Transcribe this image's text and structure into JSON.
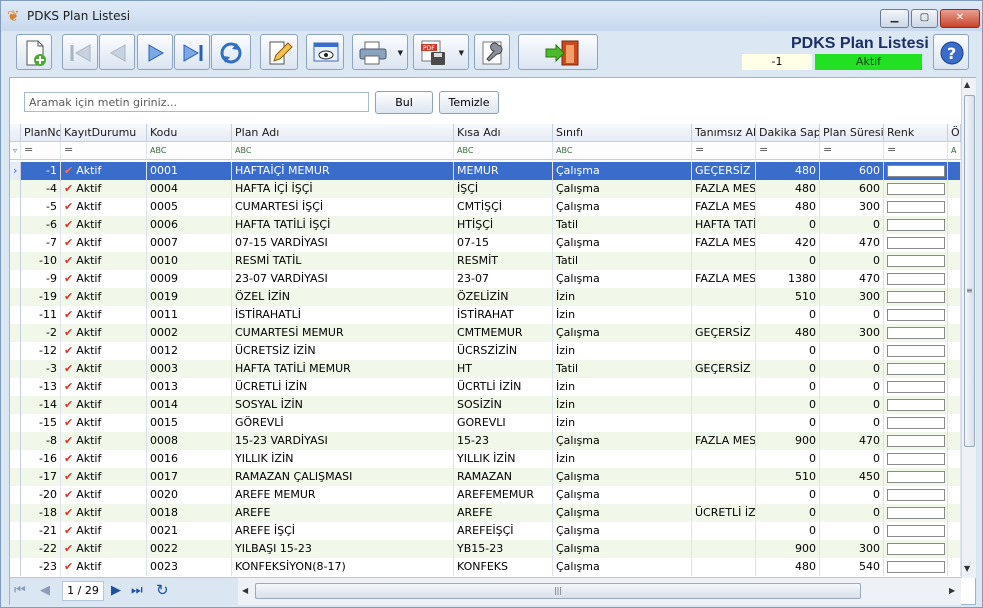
{
  "window": {
    "title": "PDKS Plan Listesi"
  },
  "toolbar": {
    "buttons": [
      {
        "name": "new-record-button",
        "icon": "new-document-icon"
      },
      {
        "name": "first-record-button",
        "icon": "first-icon"
      },
      {
        "name": "previous-record-button",
        "icon": "previous-icon"
      },
      {
        "name": "next-record-button",
        "icon": "next-icon"
      },
      {
        "name": "last-record-button",
        "icon": "last-icon"
      },
      {
        "name": "refresh-button",
        "icon": "refresh-icon"
      },
      {
        "name": "edit-button",
        "icon": "edit-icon"
      },
      {
        "name": "preview-button",
        "icon": "preview-icon"
      },
      {
        "name": "print-button",
        "icon": "printer-icon"
      },
      {
        "name": "export-pdf-button",
        "icon": "pdf-icon"
      },
      {
        "name": "settings-button",
        "icon": "wrench-icon"
      },
      {
        "name": "exit-button",
        "icon": "exit-door-icon"
      }
    ]
  },
  "header": {
    "title": "PDKS Plan Listesi",
    "record_id": "-1",
    "status": "Aktif"
  },
  "search": {
    "placeholder": "Aramak için metin giriniz...",
    "find_label": "Bul",
    "clear_label": "Temizle"
  },
  "grid": {
    "columns": [
      "PlanNo",
      "KayıtDurumu",
      "Kodu",
      "Plan Adı",
      "Kısa Adı",
      "Sınıfı",
      "Tanımsız Akt",
      "Dakika Sapm",
      "Plan Süresi",
      "Renk",
      "Ö"
    ],
    "filter_markers": [
      "=",
      "=",
      "ABC",
      "ABC",
      "ABC",
      "ABC",
      "=",
      "=",
      "=",
      "=",
      "A"
    ],
    "rows": [
      [
        "-1",
        "Aktif",
        "0001",
        "HAFTAİÇİ MEMUR",
        "MEMUR",
        "Çalışma",
        "GEÇERSİZ",
        "480",
        "600"
      ],
      [
        "-4",
        "Aktif",
        "0004",
        "HAFTA İÇİ İŞÇİ",
        "İŞÇİ",
        "Çalışma",
        "FAZLA MESA",
        "480",
        "600"
      ],
      [
        "-5",
        "Aktif",
        "0005",
        "CUMARTESİ İŞÇİ",
        "CMTİŞÇİ",
        "Çalışma",
        "FAZLA MESA",
        "480",
        "300"
      ],
      [
        "-6",
        "Aktif",
        "0006",
        "HAFTA TATİLİ İŞÇİ",
        "HTİŞÇİ",
        "Tatil",
        "HAFTA TATİ",
        "0",
        "0"
      ],
      [
        "-7",
        "Aktif",
        "0007",
        "07-15 VARDİYASI",
        "07-15",
        "Çalışma",
        "FAZLA MESA",
        "420",
        "470"
      ],
      [
        "-10",
        "Aktif",
        "0010",
        "RESMİ TATİL",
        "RESMİT",
        "Tatil",
        "",
        "0",
        "0"
      ],
      [
        "-9",
        "Aktif",
        "0009",
        "23-07 VARDİYASI",
        "23-07",
        "Çalışma",
        "FAZLA MESA",
        "1380",
        "470"
      ],
      [
        "-19",
        "Aktif",
        "0019",
        "ÖZEL İZİN",
        "ÖZELİZİN",
        "İzin",
        "",
        "510",
        "300"
      ],
      [
        "-11",
        "Aktif",
        "0011",
        "İSTİRAHATLİ",
        "İSTİRAHAT",
        "İzin",
        "",
        "0",
        "0"
      ],
      [
        "-2",
        "Aktif",
        "0002",
        "CUMARTESİ MEMUR",
        "CMTMEMUR",
        "Çalışma",
        "GEÇERSİZ",
        "480",
        "300"
      ],
      [
        "-12",
        "Aktif",
        "0012",
        "ÜCRETSİZ İZİN",
        "ÜCRSZİZİN",
        "İzin",
        "",
        "0",
        "0"
      ],
      [
        "-3",
        "Aktif",
        "0003",
        "HAFTA TATİLİ MEMUR",
        "HT",
        "Tatil",
        "GEÇERSİZ",
        "0",
        "0"
      ],
      [
        "-13",
        "Aktif",
        "0013",
        "ÜCRETLİ İZİN",
        "ÜCRTLİ İZİN",
        "İzin",
        "",
        "0",
        "0"
      ],
      [
        "-14",
        "Aktif",
        "0014",
        "SOSYAL İZİN",
        "SOSİZİN",
        "İzin",
        "",
        "0",
        "0"
      ],
      [
        "-15",
        "Aktif",
        "0015",
        "GÖREVLİ",
        "GOREVLI",
        "İzin",
        "",
        "0",
        "0"
      ],
      [
        "-8",
        "Aktif",
        "0008",
        "15-23 VARDİYASI",
        "15-23",
        "Çalışma",
        "FAZLA MESA",
        "900",
        "470"
      ],
      [
        "-16",
        "Aktif",
        "0016",
        "YILLIK İZİN",
        "YILLIK İZİN",
        "İzin",
        "",
        "0",
        "0"
      ],
      [
        "-17",
        "Aktif",
        "0017",
        "RAMAZAN ÇALIŞMASI",
        "RAMAZAN",
        "Çalışma",
        "",
        "510",
        "450"
      ],
      [
        "-20",
        "Aktif",
        "0020",
        "AREFE MEMUR",
        "AREFEMEMUR",
        "Çalışma",
        "",
        "0",
        "0"
      ],
      [
        "-18",
        "Aktif",
        "0018",
        "AREFE",
        "AREFE",
        "Çalışma",
        "ÜCRETLİ İZİ",
        "0",
        "0"
      ],
      [
        "-21",
        "Aktif",
        "0021",
        "AREFE İŞÇİ",
        "AREFEİŞÇİ",
        "Çalışma",
        "",
        "0",
        "0"
      ],
      [
        "-22",
        "Aktif",
        "0022",
        "YILBAŞI 15-23",
        "YB15-23",
        "Çalışma",
        "",
        "900",
        "300"
      ],
      [
        "-23",
        "Aktif",
        "0023",
        "KONFEKSİYON(8-17)",
        "KONFEKS",
        "Çalışma",
        "",
        "480",
        "540"
      ]
    ],
    "selected_row": 0
  },
  "navigator": {
    "page_text": "1 / 29"
  },
  "colors": {
    "selected_row": "#3a6ccc",
    "alt_row": "#f1f8e9",
    "status_active": "#22e022",
    "check_mark": "#d8362a"
  }
}
